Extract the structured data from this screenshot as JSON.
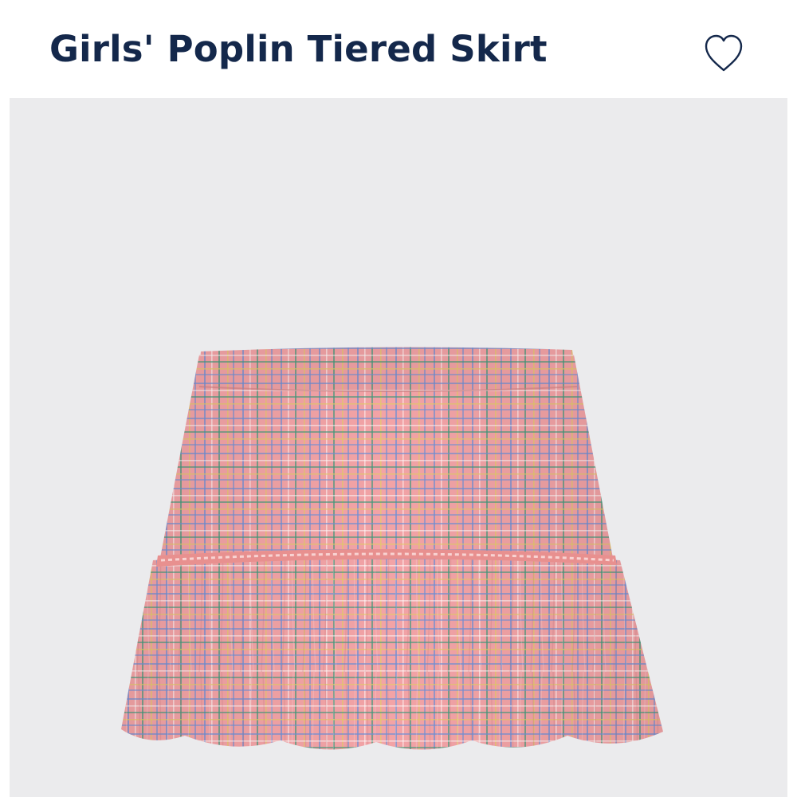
{
  "product": {
    "title": "Girls' Poplin Tiered Skirt",
    "wishlist_icon": "heart-outline-icon",
    "image_subject": "pink-plaid-tiered-skirt"
  },
  "colors": {
    "title": "#14284b",
    "image_background": "#ebebed",
    "skirt_base": "#f2a3a6",
    "skirt_trim": "#e8908f",
    "heart_stroke": "#14284b"
  }
}
